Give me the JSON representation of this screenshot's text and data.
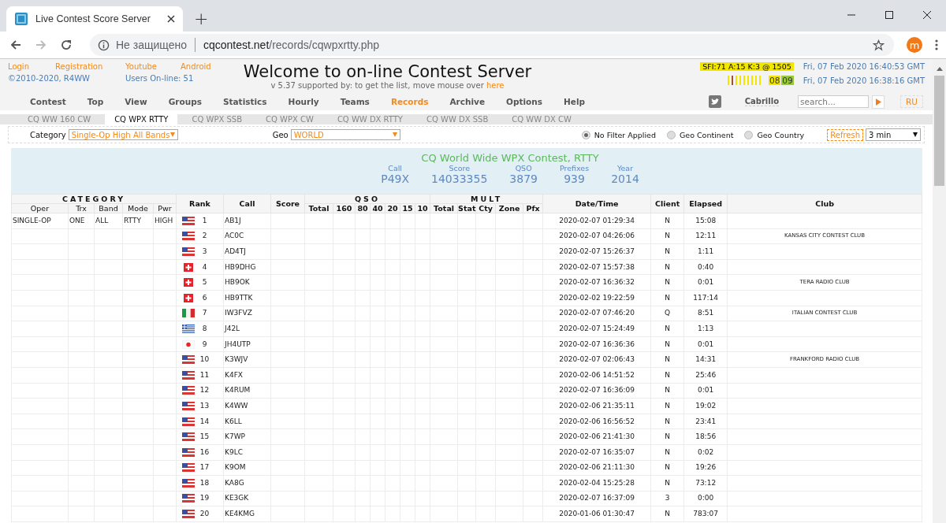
{
  "browser": {
    "tab_title": "Live Contest Score Server",
    "new_tab": "+",
    "security": "Не защищено",
    "url_host": "cqcontest.net",
    "url_path": "/records/cqwpxrtty.php",
    "profile": "m"
  },
  "header": {
    "links": [
      "Login",
      "Registration",
      "Youtube",
      "Android"
    ],
    "copyright": "©2010-2020, R4WW",
    "users_online": "Users On-line: 51",
    "title": "Welcome to on-line Contest Server",
    "subtitle": "v 5.37 supported by: to get the list, move mouse over ",
    "subtitle_link": "here",
    "solar": "SFI:71 A:15 K:3 @ 1505",
    "bands": [
      {
        "label": "08",
        "color": "#f2e600"
      },
      {
        "label": "09",
        "color": "#99cc33"
      }
    ],
    "times": [
      "Fri, 07 Feb 2020 16:40:53 GMT",
      "Fri, 07 Feb 2020 16:38:16 GMT"
    ]
  },
  "menu": [
    {
      "label": "Contest",
      "selected": false
    },
    {
      "label": "Top",
      "selected": false
    },
    {
      "label": "View",
      "selected": false
    },
    {
      "label": "Groups",
      "selected": false
    },
    {
      "label": "Statistics",
      "selected": false
    },
    {
      "label": "Hourly",
      "selected": false
    },
    {
      "label": "Teams",
      "selected": false
    },
    {
      "label": "Records",
      "selected": true
    },
    {
      "label": "Archive",
      "selected": false
    },
    {
      "label": "Options",
      "selected": false
    },
    {
      "label": "Help",
      "selected": false
    }
  ],
  "cabrillo": "Cabrillo",
  "search": {
    "placeholder": "search..."
  },
  "lang": "RU",
  "contest_tabs": [
    {
      "label": "CQ WW 160 CW",
      "selected": false
    },
    {
      "label": "CQ WPX RTTY",
      "selected": true
    },
    {
      "label": "CQ WPX SSB",
      "selected": false
    },
    {
      "label": "CQ WPX CW",
      "selected": false
    },
    {
      "label": "CQ WW DX RTTY",
      "selected": false
    },
    {
      "label": "CQ WW DX SSB",
      "selected": false
    },
    {
      "label": "CQ WW DX CW",
      "selected": false
    }
  ],
  "filter": {
    "category_label": "Category",
    "category": "Single-Op High All Bands",
    "geo_label": "Geo",
    "geo": "WORLD",
    "options": [
      {
        "label": "No Filter Applied",
        "selected": true
      },
      {
        "label": "Geo Continent",
        "selected": false
      },
      {
        "label": "Geo Country",
        "selected": false
      }
    ],
    "refresh": "Refresh",
    "interval": "3 min"
  },
  "record": {
    "title": "CQ World Wide WPX Contest, RTTY",
    "stats": [
      {
        "label": "Call",
        "value": "P49X"
      },
      {
        "label": "Score",
        "value": "14033355"
      },
      {
        "label": "QSO",
        "value": "3879"
      },
      {
        "label": "Prefixes",
        "value": "939"
      },
      {
        "label": "Year",
        "value": "2014"
      }
    ]
  },
  "table": {
    "category_group": "CATEGORY",
    "qso_group": "QSO",
    "mult_group": "MULT",
    "category_columns": [
      "Oper",
      "Trx",
      "Band",
      "Mode",
      "Pwr"
    ],
    "rank": "Rank",
    "call": "Call",
    "score": "Score",
    "qso_columns": [
      "Total",
      "160",
      "80",
      "40",
      "20",
      "15",
      "10"
    ],
    "mult_columns": [
      "Total",
      "Stat",
      "Cty",
      "Zone",
      "Pfx"
    ],
    "datetime": "Date/Time",
    "client": "Client",
    "elapsed": "Elapsed",
    "club": "Club",
    "rows": [
      {
        "category": [
          "SINGLE-OP",
          "ONE",
          "ALL",
          "RTTY",
          "HIGH"
        ],
        "flag": {
          "kind": "us"
        },
        "rank": "1",
        "call": "AB1J",
        "time": "2020-02-07 01:29:34",
        "client": "N",
        "elapsed": "15:08"
      },
      {
        "flag": {
          "kind": "us"
        },
        "rank": "2",
        "call": "AC0C",
        "time": "2020-02-07 04:26:06",
        "client": "N",
        "elapsed": "12:11",
        "club": "KANSAS CITY CONTEST CLUB"
      },
      {
        "flag": {
          "kind": "us"
        },
        "rank": "3",
        "call": "AD4TJ",
        "time": "2020-02-07 15:26:37",
        "client": "N",
        "elapsed": "1:11"
      },
      {
        "flag": {
          "kind": "ch"
        },
        "rank": "4",
        "call": "HB9DHG",
        "time": "2020-02-07 15:57:38",
        "client": "N",
        "elapsed": "0:40"
      },
      {
        "flag": {
          "kind": "ch"
        },
        "rank": "5",
        "call": "HB9OK",
        "time": "2020-02-07 16:36:32",
        "client": "N",
        "elapsed": "0:01",
        "club": "TERA RADIO CLUB"
      },
      {
        "flag": {
          "kind": "ch"
        },
        "rank": "6",
        "call": "HB9TTK",
        "time": "2020-02-02 19:22:59",
        "client": "N",
        "elapsed": "117:14"
      },
      {
        "flag": {
          "kind": "it"
        },
        "rank": "7",
        "call": "IW3FVZ",
        "time": "2020-02-07 07:46:20",
        "client": "Q",
        "elapsed": "8:51",
        "club": "ITALIAN CONTEST CLUB"
      },
      {
        "flag": {
          "kind": "gr"
        },
        "rank": "8",
        "call": "J42L",
        "time": "2020-02-07 15:24:49",
        "client": "N",
        "elapsed": "1:13"
      },
      {
        "flag": {
          "kind": "jp"
        },
        "rank": "9",
        "call": "JH4UTP",
        "time": "2020-02-07 16:36:36",
        "client": "N",
        "elapsed": "0:01"
      },
      {
        "flag": {
          "kind": "us"
        },
        "rank": "10",
        "call": "K3WJV",
        "time": "2020-02-07 02:06:43",
        "client": "N",
        "elapsed": "14:31",
        "club": "FRANKFORD RADIO CLUB"
      },
      {
        "flag": {
          "kind": "us"
        },
        "rank": "11",
        "call": "K4FX",
        "time": "2020-02-06 14:51:52",
        "client": "N",
        "elapsed": "25:46"
      },
      {
        "flag": {
          "kind": "us"
        },
        "rank": "12",
        "call": "K4RUM",
        "time": "2020-02-07 16:36:09",
        "client": "N",
        "elapsed": "0:01"
      },
      {
        "flag": {
          "kind": "us"
        },
        "rank": "13",
        "call": "K4WW",
        "time": "2020-02-06 21:35:11",
        "client": "N",
        "elapsed": "19:02"
      },
      {
        "flag": {
          "kind": "us"
        },
        "rank": "14",
        "call": "K6LL",
        "time": "2020-02-06 16:56:52",
        "client": "N",
        "elapsed": "23:41"
      },
      {
        "flag": {
          "kind": "us"
        },
        "rank": "15",
        "call": "K7WP",
        "time": "2020-02-06 21:41:30",
        "client": "N",
        "elapsed": "18:56"
      },
      {
        "flag": {
          "kind": "us"
        },
        "rank": "16",
        "call": "K9LC",
        "time": "2020-02-07 16:35:07",
        "client": "N",
        "elapsed": "0:02"
      },
      {
        "flag": {
          "kind": "us"
        },
        "rank": "17",
        "call": "K9OM",
        "time": "2020-02-06 21:11:30",
        "client": "N",
        "elapsed": "19:26"
      },
      {
        "flag": {
          "kind": "us"
        },
        "rank": "18",
        "call": "KA8G",
        "time": "2020-02-04 15:25:28",
        "client": "N",
        "elapsed": "73:12"
      },
      {
        "flag": {
          "kind": "us"
        },
        "rank": "19",
        "call": "KE3GK",
        "time": "2020-02-07 16:37:09",
        "client": "3",
        "elapsed": "0:00"
      },
      {
        "flag": {
          "kind": "us"
        },
        "rank": "20",
        "call": "KE4KMG",
        "time": "2020-01-06 01:30:47",
        "client": "N",
        "elapsed": "783:07"
      }
    ]
  }
}
